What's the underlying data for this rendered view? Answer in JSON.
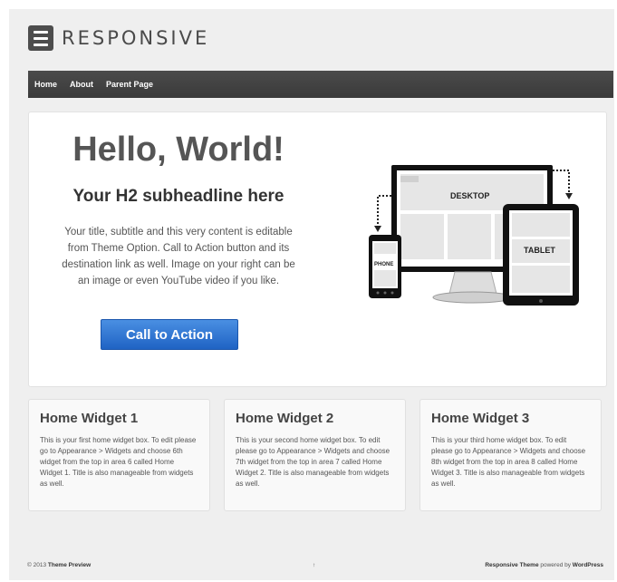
{
  "header": {
    "logo_text": "RESPONSIVE"
  },
  "nav": {
    "items": [
      {
        "label": "Home"
      },
      {
        "label": "About"
      },
      {
        "label": "Parent Page"
      }
    ]
  },
  "featured": {
    "title": "Hello, World!",
    "subtitle": "Your H2 subheadline here",
    "text": "Your title, subtitle and this very content is editable from Theme Option. Call to Action button and its destination link as well. Image on your right can be an image or even YouTube video if you like.",
    "cta_label": "Call to Action",
    "devices": {
      "desktop_label": "DESKTOP",
      "tablet_label": "TABLET",
      "phone_label": "PHONE"
    }
  },
  "widgets": [
    {
      "title": "Home Widget 1",
      "text": "This is your first home widget box. To edit please go to Appearance > Widgets and choose 6th widget from the top in area 6 called Home Widget 1. Title is also manageable from widgets as well."
    },
    {
      "title": "Home Widget 2",
      "text": "This is your second home widget box. To edit please go to Appearance > Widgets and choose 7th widget from the top in area 7 called Home Widget 2. Title is also manageable from widgets as well."
    },
    {
      "title": "Home Widget 3",
      "text": "This is your third home widget box. To edit please go to Appearance > Widgets and choose 8th widget from the top in area 8 called Home Widget 3. Title is also manageable from widgets as well."
    }
  ],
  "footer": {
    "copyright_prefix": "© 2013",
    "site_name": "Theme Preview",
    "scroll_top": "↑",
    "theme_name": "Responsive Theme",
    "powered_text": "powered by",
    "platform": "WordPress"
  }
}
